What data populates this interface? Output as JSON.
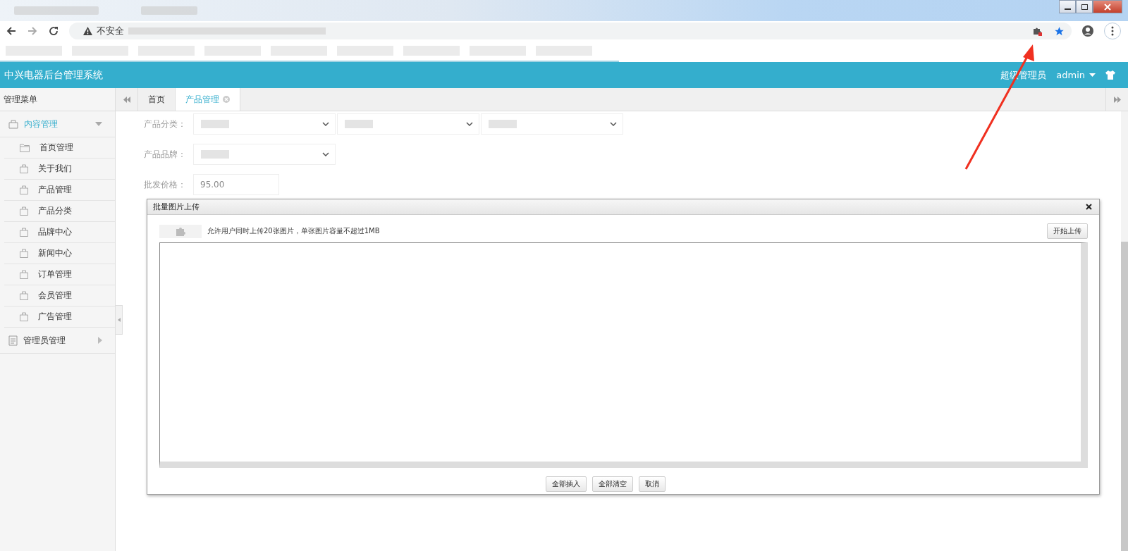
{
  "browser": {
    "security_label": "不安全"
  },
  "app": {
    "title": "中兴电器后台管理系统",
    "user_role": "超级管理员",
    "username": "admin"
  },
  "sidebar": {
    "heading": "管理菜单",
    "groups": [
      {
        "label": "内容管理",
        "selected": true,
        "expanded": true,
        "children": [
          {
            "label": "首页管理",
            "kind": "folder"
          },
          {
            "label": "关于我们",
            "kind": "bag"
          },
          {
            "label": "产品管理",
            "kind": "bag"
          },
          {
            "label": "产品分类",
            "kind": "bag"
          },
          {
            "label": "品牌中心",
            "kind": "bag"
          },
          {
            "label": "新闻中心",
            "kind": "bag"
          },
          {
            "label": "订单管理",
            "kind": "bag"
          },
          {
            "label": "会员管理",
            "kind": "bag"
          },
          {
            "label": "广告管理",
            "kind": "bag"
          }
        ]
      },
      {
        "label": "管理员管理",
        "selected": false,
        "expanded": false,
        "kind": "document"
      }
    ]
  },
  "tabs": [
    {
      "label": "首页",
      "selected": false,
      "closable": false
    },
    {
      "label": "产品管理",
      "selected": true,
      "closable": true
    }
  ],
  "form": {
    "rows": [
      {
        "label": "产品分类：",
        "controls": [
          {
            "kind": "select"
          },
          {
            "kind": "select"
          },
          {
            "kind": "select"
          }
        ]
      },
      {
        "label": "产品品牌：",
        "controls": [
          {
            "kind": "select"
          }
        ]
      },
      {
        "label": "批发价格：",
        "controls": [
          {
            "kind": "input",
            "value": "95.00"
          }
        ]
      }
    ]
  },
  "dialog": {
    "title": "批量图片上传",
    "hint": "允许用户同时上传20张图片，单张图片容量不超过1MB",
    "upload_button": "开始上传",
    "buttons": [
      "全部插入",
      "全部清空",
      "取消"
    ]
  }
}
